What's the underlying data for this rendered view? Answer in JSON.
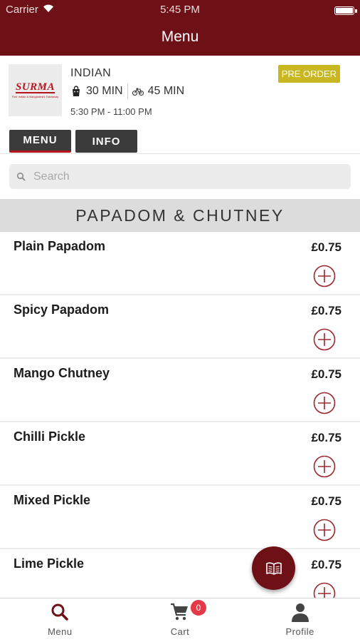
{
  "status_bar": {
    "carrier": "Carrier",
    "time": "5:45 PM",
    "wifi_icon": "wifi-icon",
    "battery_icon": "battery-icon"
  },
  "nav": {
    "title": "Menu"
  },
  "restaurant": {
    "logo_text": "SURMA",
    "logo_subtext": "Fine Indian & Bangladeshi Takeaway",
    "cuisine": "INDIAN",
    "collection_time": "30 MIN",
    "delivery_time": "45 MIN",
    "hours": "5:30 PM - 11:00 PM",
    "preorder_label": "PRE ORDER"
  },
  "tabs": [
    {
      "label": "MENU",
      "active": true
    },
    {
      "label": "INFO",
      "active": false
    }
  ],
  "search": {
    "placeholder": "Search",
    "value": ""
  },
  "category": {
    "title": "PAPADOM & CHUTNEY"
  },
  "items": [
    {
      "name": "Plain Papadom",
      "price": "£0.75"
    },
    {
      "name": "Spicy Papadom",
      "price": "£0.75"
    },
    {
      "name": "Mango Chutney",
      "price": "£0.75"
    },
    {
      "name": "Chilli Pickle",
      "price": "£0.75"
    },
    {
      "name": "Mixed Pickle",
      "price": "£0.75"
    },
    {
      "name": "Lime Pickle",
      "price": "£0.75"
    }
  ],
  "fab": {
    "icon": "menu-book-icon"
  },
  "bottom_nav": [
    {
      "label": "Menu",
      "icon": "search-icon"
    },
    {
      "label": "Cart",
      "icon": "cart-icon",
      "badge": "0"
    },
    {
      "label": "Profile",
      "icon": "profile-icon"
    }
  ],
  "colors": {
    "brand": "#6e1116",
    "accent": "#b8141c",
    "preorder": "#c9b722",
    "badge": "#e53948"
  }
}
